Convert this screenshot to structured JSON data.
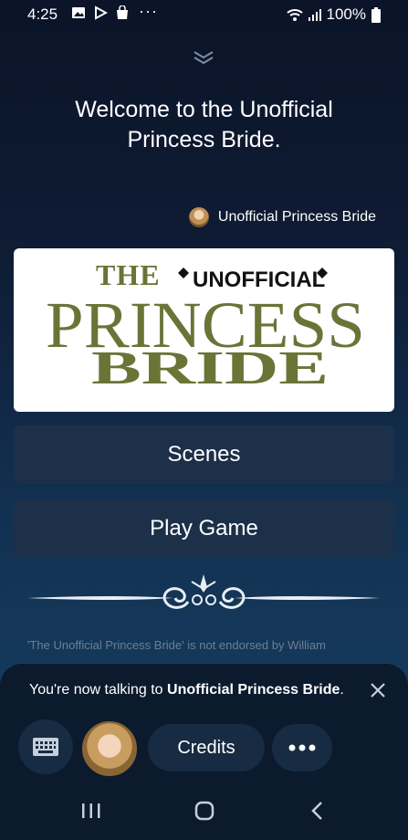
{
  "status_bar": {
    "time": "4:25",
    "battery": "100%",
    "more_indicator": "···"
  },
  "header": {
    "welcome_line1": "Welcome to the Unofficial",
    "welcome_line2": "Princess Bride.",
    "bot_name": "Unofficial Princess Bride"
  },
  "logo": {
    "the": "THE",
    "unofficial": "UNOFFICIAL",
    "princess": "PRINCESS",
    "bride": "BRIDE",
    "color": "#6b7337"
  },
  "buttons": {
    "scenes": "Scenes",
    "play_game": "Play Game"
  },
  "disclaimer": "'The Unofficial Princess Bride' is not endorsed by William",
  "sheet": {
    "msg_prefix": "You're now talking to ",
    "msg_bold": "Unofficial Princess Bride",
    "msg_suffix": ".",
    "credits": "Credits"
  },
  "colors": {
    "background_top": "#0b1428",
    "background_bottom": "#174266",
    "button_bg": "#1c3049",
    "sheet_bg": "#0c1a2e"
  },
  "icons": [
    "image-icon",
    "play-store-icon",
    "shopping-bag-icon",
    "wifi-icon",
    "signal-icon",
    "battery-icon",
    "chevron-double-down-icon",
    "close-icon",
    "keyboard-icon",
    "more-icon",
    "recents-icon",
    "home-icon",
    "back-icon"
  ]
}
